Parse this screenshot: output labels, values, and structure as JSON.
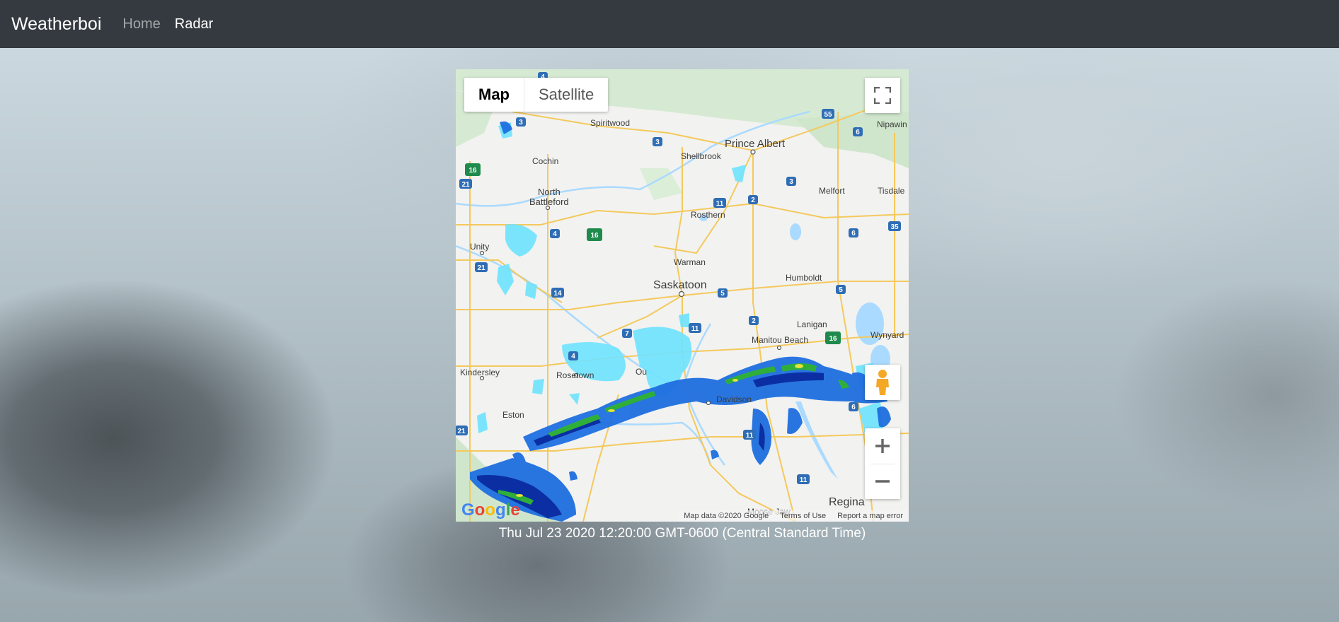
{
  "navbar": {
    "brand": "Weatherboi",
    "links": [
      {
        "label": "Home",
        "active": false
      },
      {
        "label": "Radar",
        "active": true
      }
    ]
  },
  "map": {
    "type_buttons": {
      "map": "Map",
      "satellite": "Satellite"
    },
    "selected_type": "Map",
    "cities": {
      "spiritwood": "Spiritwood",
      "prince_albert": "Prince Albert",
      "shellbrook": "Shellbrook",
      "nipawin": "Nipawin",
      "cochin": "Cochin",
      "north_battleford_1": "North",
      "north_battleford_2": "Battleford",
      "melfort": "Melfort",
      "tisdale": "Tisdale",
      "rosthern": "Rosthern",
      "unity": "Unity",
      "warman": "Warman",
      "saskatoon": "Saskatoon",
      "humboldt": "Humboldt",
      "lanigan": "Lanigan",
      "manitou_beach": "Manitou Beach",
      "wynyard": "Wynyard",
      "kindersley": "Kindersley",
      "rosetown": "Rosetown",
      "outlook": "Ou",
      "davidson": "Davidson",
      "eston": "Eston",
      "regina": "Regina",
      "moose_jaw": "Moose Jaw"
    },
    "highway_shields": {
      "h3a": "3",
      "h4a": "4",
      "h3b": "3",
      "h16a": "16",
      "h21a": "21",
      "h55": "55",
      "h6a": "6",
      "h3c": "3",
      "h11a": "11",
      "h2a": "2",
      "h4b": "4",
      "h16b": "16",
      "h6b": "6",
      "h35": "35",
      "h21b": "21",
      "h14": "14",
      "h5a": "5",
      "h5b": "5",
      "h7": "7",
      "h11b": "11",
      "h2b": "2",
      "h16c": "16",
      "h4c": "4",
      "h21c": "21",
      "h11c": "11",
      "h6c": "6",
      "h11d": "11"
    },
    "attribution": {
      "map_data": "Map data ©2020 Google",
      "terms": "Terms of Use",
      "report": "Report a map error"
    },
    "logo": "Google",
    "icons": {
      "fullscreen": "fullscreen-icon",
      "pegman": "pegman-icon",
      "zoom_in": "plus-icon",
      "zoom_out": "minus-icon"
    }
  },
  "timestamp": "Thu Jul 23 2020 12:20:00 GMT-0600 (Central Standard Time)",
  "colors": {
    "navbar": "#343a40",
    "shield": "#2f6db5",
    "shield_green": "#1e8a4c",
    "road": "#f4c95d",
    "radar_light": "#6fe3ff",
    "radar_mid": "#1f6fe0",
    "radar_dark": "#0b2fa3",
    "radar_green": "#2faf3a",
    "radar_yellow": "#e6e23a"
  }
}
